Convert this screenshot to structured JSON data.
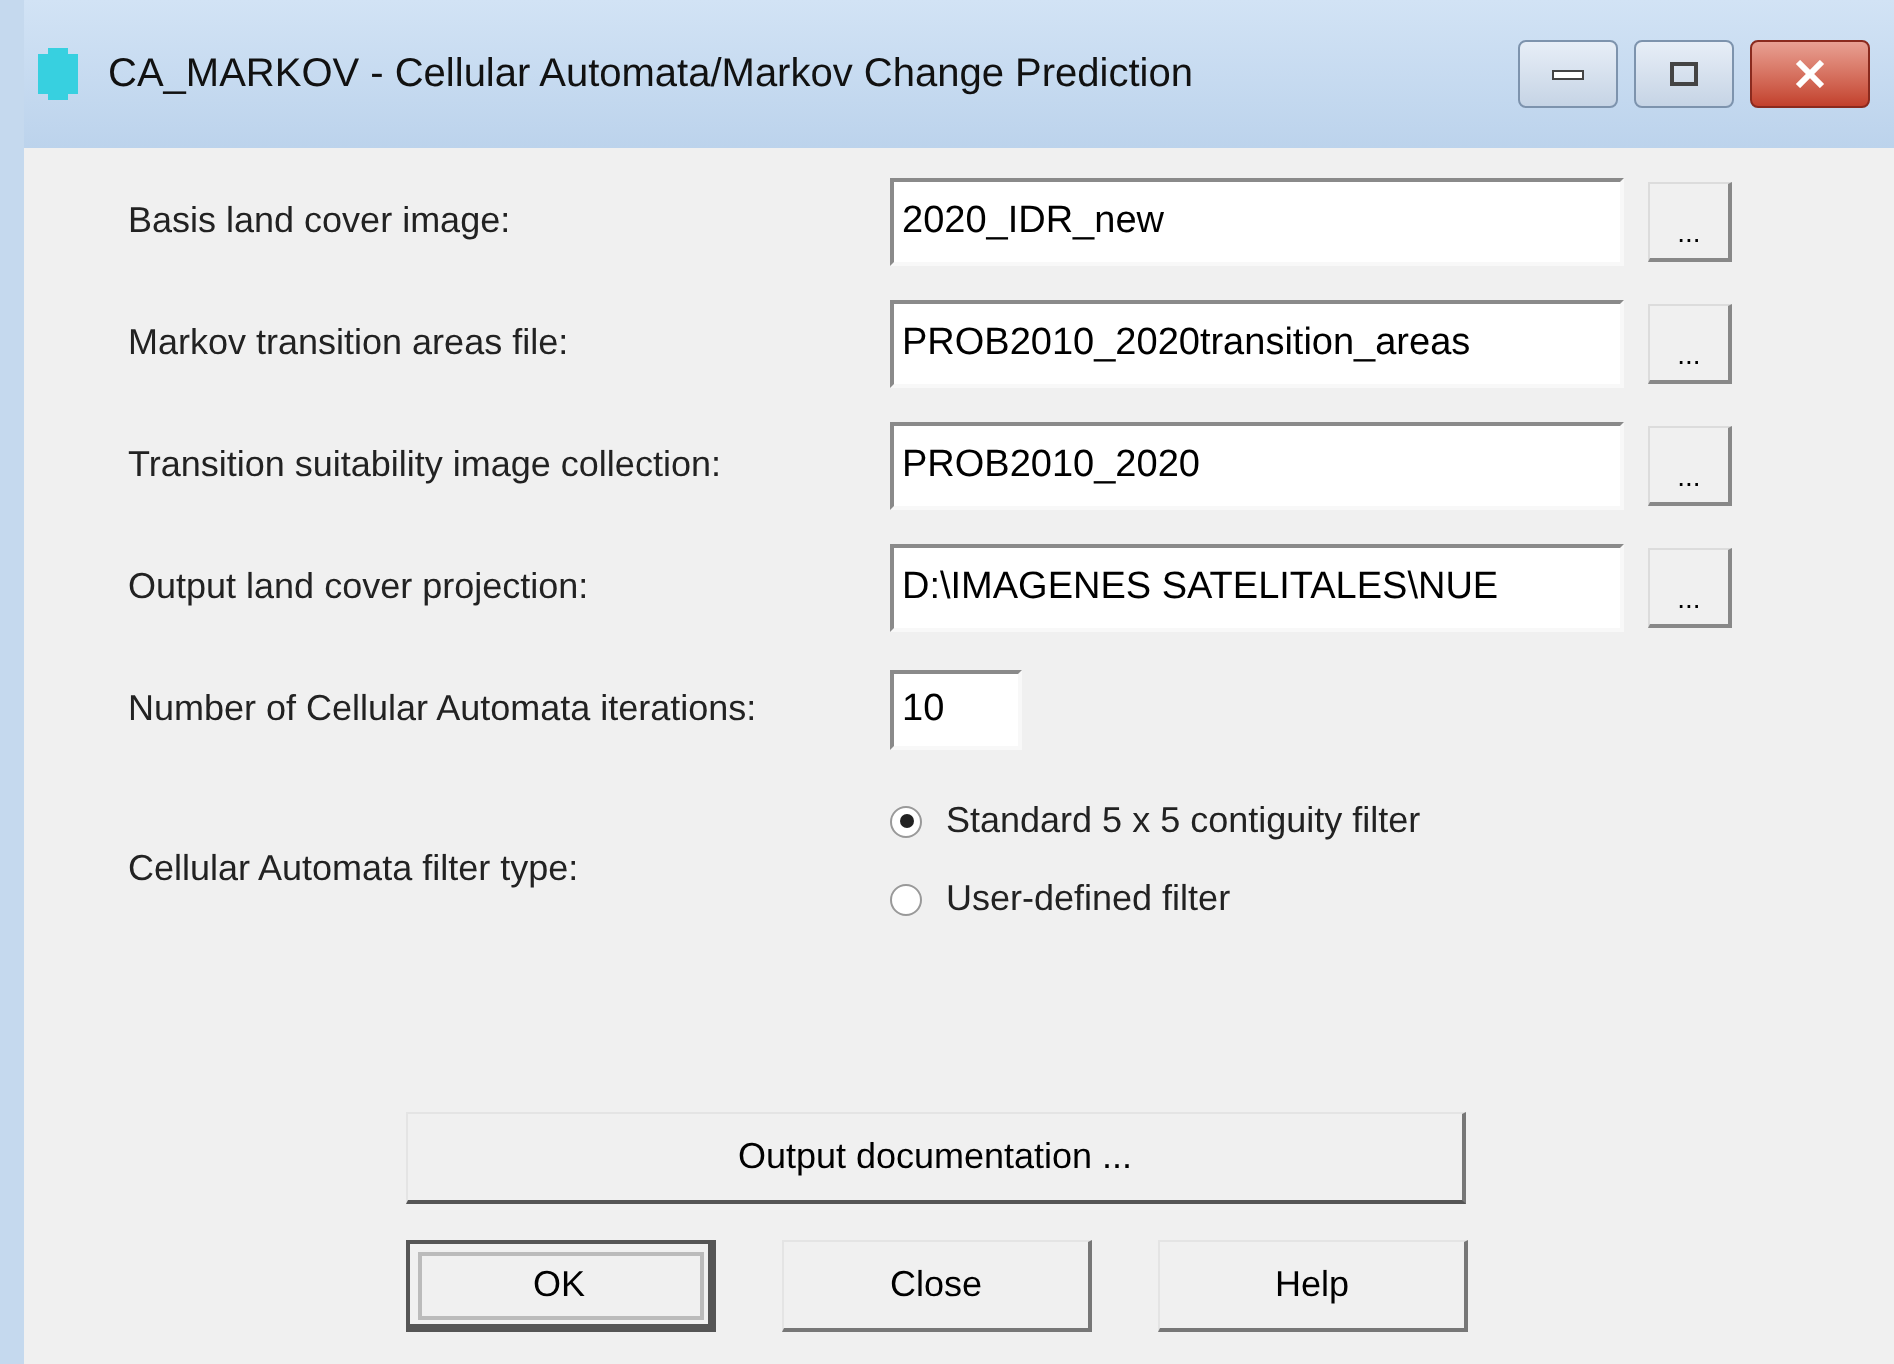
{
  "window": {
    "title": "CA_MARKOV - Cellular Automata/Markov Change Prediction"
  },
  "fields": [
    {
      "kind": "file",
      "label": "Basis land cover image:",
      "value": "2020_IDR_new",
      "browse": "..."
    },
    {
      "kind": "file",
      "label": "Markov transition areas file:",
      "value": "PROB2010_2020transition_areas",
      "browse": "..."
    },
    {
      "kind": "file",
      "label": "Transition suitability image collection:",
      "value": "PROB2010_2020",
      "browse": "..."
    },
    {
      "kind": "file",
      "label": "Output land cover projection:",
      "value": "D:\\IMAGENES SATELITALES\\NUE",
      "browse": "..."
    },
    {
      "kind": "number",
      "label": "Number of Cellular Automata iterations:",
      "value": "10"
    }
  ],
  "filter": {
    "label": "Cellular Automata filter type:",
    "options": [
      {
        "label": "Standard 5 x 5 contiguity filter",
        "selected": true
      },
      {
        "label": "User-defined filter",
        "selected": false
      }
    ]
  },
  "doc_button": "Output documentation ...",
  "buttons": [
    {
      "label": "OK",
      "default": true
    },
    {
      "label": "Close",
      "default": false
    },
    {
      "label": "Help",
      "default": false
    }
  ]
}
